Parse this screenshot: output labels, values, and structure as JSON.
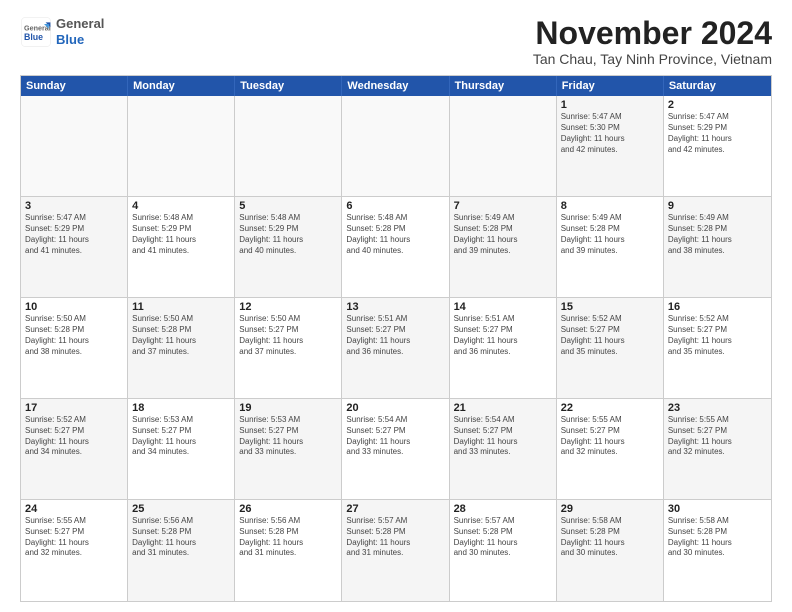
{
  "logo": {
    "general": "General",
    "blue": "Blue"
  },
  "header": {
    "month": "November 2024",
    "location": "Tan Chau, Tay Ninh Province, Vietnam"
  },
  "days_of_week": [
    "Sunday",
    "Monday",
    "Tuesday",
    "Wednesday",
    "Thursday",
    "Friday",
    "Saturday"
  ],
  "weeks": [
    [
      {
        "day": "",
        "info": "",
        "empty": true
      },
      {
        "day": "",
        "info": "",
        "empty": true
      },
      {
        "day": "",
        "info": "",
        "empty": true
      },
      {
        "day": "",
        "info": "",
        "empty": true
      },
      {
        "day": "",
        "info": "",
        "empty": true
      },
      {
        "day": "1",
        "info": "Sunrise: 5:47 AM\nSunset: 5:30 PM\nDaylight: 11 hours\nand 42 minutes.",
        "empty": false,
        "shaded": true
      },
      {
        "day": "2",
        "info": "Sunrise: 5:47 AM\nSunset: 5:29 PM\nDaylight: 11 hours\nand 42 minutes.",
        "empty": false,
        "shaded": false
      }
    ],
    [
      {
        "day": "3",
        "info": "Sunrise: 5:47 AM\nSunset: 5:29 PM\nDaylight: 11 hours\nand 41 minutes.",
        "empty": false,
        "shaded": true
      },
      {
        "day": "4",
        "info": "Sunrise: 5:48 AM\nSunset: 5:29 PM\nDaylight: 11 hours\nand 41 minutes.",
        "empty": false,
        "shaded": false
      },
      {
        "day": "5",
        "info": "Sunrise: 5:48 AM\nSunset: 5:29 PM\nDaylight: 11 hours\nand 40 minutes.",
        "empty": false,
        "shaded": true
      },
      {
        "day": "6",
        "info": "Sunrise: 5:48 AM\nSunset: 5:28 PM\nDaylight: 11 hours\nand 40 minutes.",
        "empty": false,
        "shaded": false
      },
      {
        "day": "7",
        "info": "Sunrise: 5:49 AM\nSunset: 5:28 PM\nDaylight: 11 hours\nand 39 minutes.",
        "empty": false,
        "shaded": true
      },
      {
        "day": "8",
        "info": "Sunrise: 5:49 AM\nSunset: 5:28 PM\nDaylight: 11 hours\nand 39 minutes.",
        "empty": false,
        "shaded": false
      },
      {
        "day": "9",
        "info": "Sunrise: 5:49 AM\nSunset: 5:28 PM\nDaylight: 11 hours\nand 38 minutes.",
        "empty": false,
        "shaded": true
      }
    ],
    [
      {
        "day": "10",
        "info": "Sunrise: 5:50 AM\nSunset: 5:28 PM\nDaylight: 11 hours\nand 38 minutes.",
        "empty": false,
        "shaded": false
      },
      {
        "day": "11",
        "info": "Sunrise: 5:50 AM\nSunset: 5:28 PM\nDaylight: 11 hours\nand 37 minutes.",
        "empty": false,
        "shaded": true
      },
      {
        "day": "12",
        "info": "Sunrise: 5:50 AM\nSunset: 5:27 PM\nDaylight: 11 hours\nand 37 minutes.",
        "empty": false,
        "shaded": false
      },
      {
        "day": "13",
        "info": "Sunrise: 5:51 AM\nSunset: 5:27 PM\nDaylight: 11 hours\nand 36 minutes.",
        "empty": false,
        "shaded": true
      },
      {
        "day": "14",
        "info": "Sunrise: 5:51 AM\nSunset: 5:27 PM\nDaylight: 11 hours\nand 36 minutes.",
        "empty": false,
        "shaded": false
      },
      {
        "day": "15",
        "info": "Sunrise: 5:52 AM\nSunset: 5:27 PM\nDaylight: 11 hours\nand 35 minutes.",
        "empty": false,
        "shaded": true
      },
      {
        "day": "16",
        "info": "Sunrise: 5:52 AM\nSunset: 5:27 PM\nDaylight: 11 hours\nand 35 minutes.",
        "empty": false,
        "shaded": false
      }
    ],
    [
      {
        "day": "17",
        "info": "Sunrise: 5:52 AM\nSunset: 5:27 PM\nDaylight: 11 hours\nand 34 minutes.",
        "empty": false,
        "shaded": true
      },
      {
        "day": "18",
        "info": "Sunrise: 5:53 AM\nSunset: 5:27 PM\nDaylight: 11 hours\nand 34 minutes.",
        "empty": false,
        "shaded": false
      },
      {
        "day": "19",
        "info": "Sunrise: 5:53 AM\nSunset: 5:27 PM\nDaylight: 11 hours\nand 33 minutes.",
        "empty": false,
        "shaded": true
      },
      {
        "day": "20",
        "info": "Sunrise: 5:54 AM\nSunset: 5:27 PM\nDaylight: 11 hours\nand 33 minutes.",
        "empty": false,
        "shaded": false
      },
      {
        "day": "21",
        "info": "Sunrise: 5:54 AM\nSunset: 5:27 PM\nDaylight: 11 hours\nand 33 minutes.",
        "empty": false,
        "shaded": true
      },
      {
        "day": "22",
        "info": "Sunrise: 5:55 AM\nSunset: 5:27 PM\nDaylight: 11 hours\nand 32 minutes.",
        "empty": false,
        "shaded": false
      },
      {
        "day": "23",
        "info": "Sunrise: 5:55 AM\nSunset: 5:27 PM\nDaylight: 11 hours\nand 32 minutes.",
        "empty": false,
        "shaded": true
      }
    ],
    [
      {
        "day": "24",
        "info": "Sunrise: 5:55 AM\nSunset: 5:27 PM\nDaylight: 11 hours\nand 32 minutes.",
        "empty": false,
        "shaded": false
      },
      {
        "day": "25",
        "info": "Sunrise: 5:56 AM\nSunset: 5:28 PM\nDaylight: 11 hours\nand 31 minutes.",
        "empty": false,
        "shaded": true
      },
      {
        "day": "26",
        "info": "Sunrise: 5:56 AM\nSunset: 5:28 PM\nDaylight: 11 hours\nand 31 minutes.",
        "empty": false,
        "shaded": false
      },
      {
        "day": "27",
        "info": "Sunrise: 5:57 AM\nSunset: 5:28 PM\nDaylight: 11 hours\nand 31 minutes.",
        "empty": false,
        "shaded": true
      },
      {
        "day": "28",
        "info": "Sunrise: 5:57 AM\nSunset: 5:28 PM\nDaylight: 11 hours\nand 30 minutes.",
        "empty": false,
        "shaded": false
      },
      {
        "day": "29",
        "info": "Sunrise: 5:58 AM\nSunset: 5:28 PM\nDaylight: 11 hours\nand 30 minutes.",
        "empty": false,
        "shaded": true
      },
      {
        "day": "30",
        "info": "Sunrise: 5:58 AM\nSunset: 5:28 PM\nDaylight: 11 hours\nand 30 minutes.",
        "empty": false,
        "shaded": false
      }
    ]
  ]
}
